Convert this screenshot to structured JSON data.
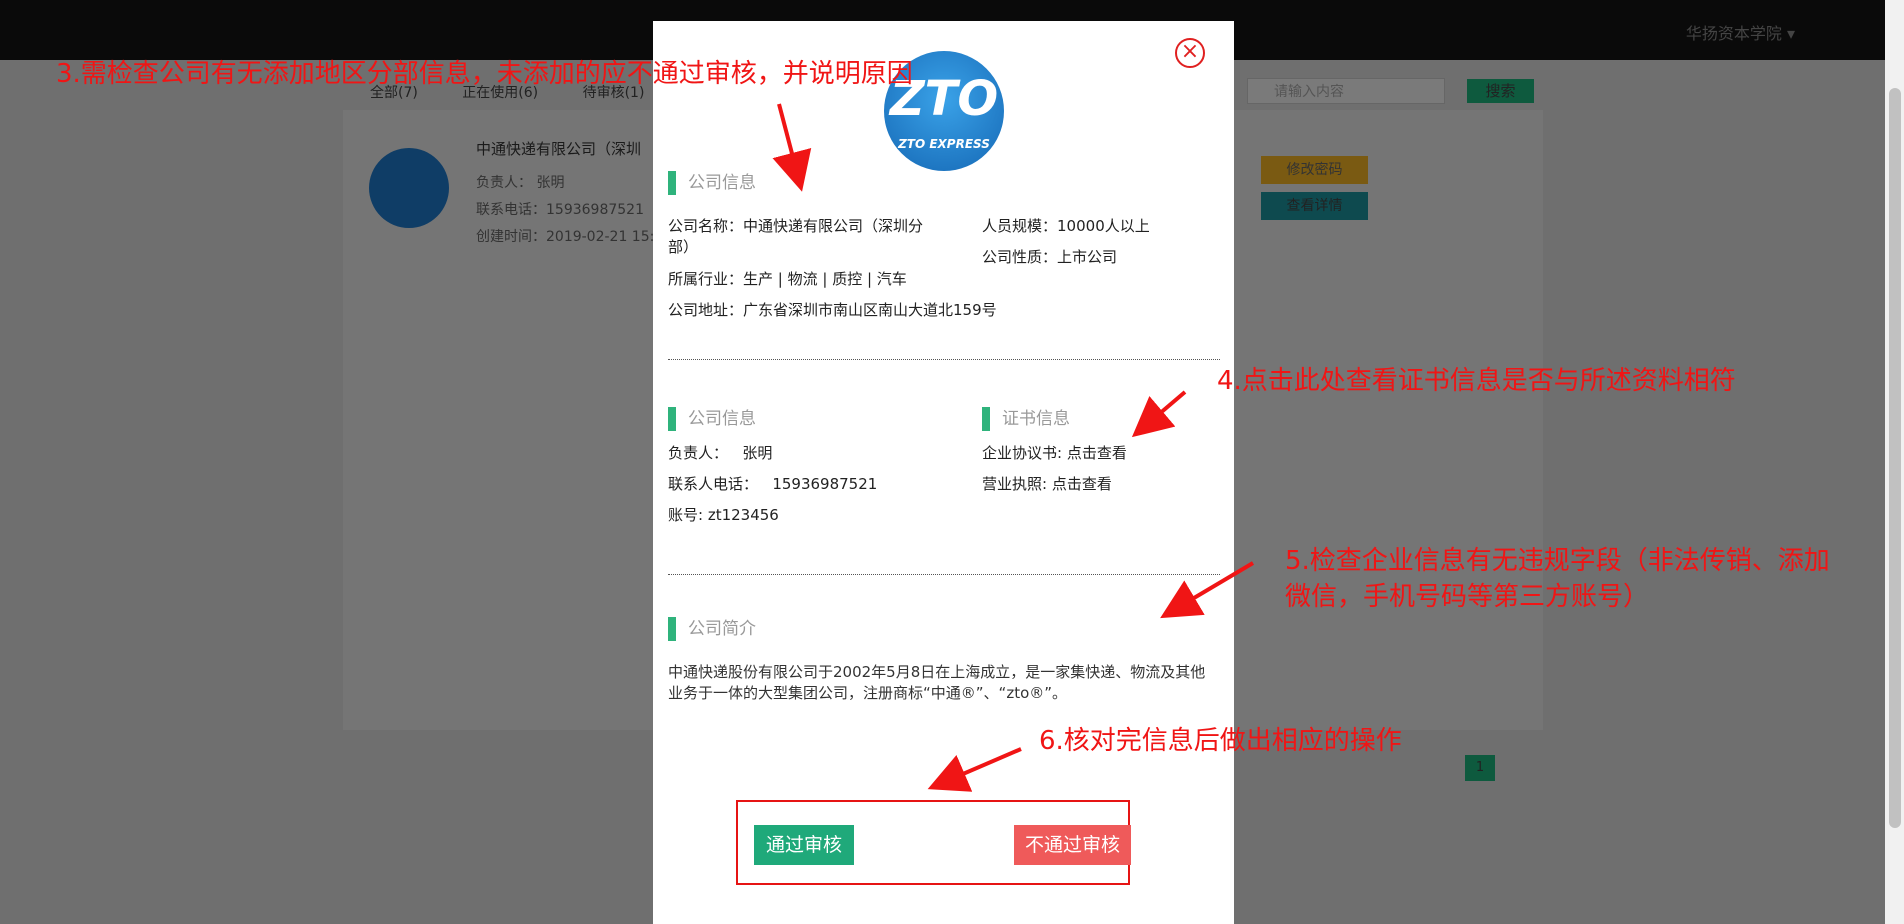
{
  "header": {
    "user_menu": "华扬资本学院 ▾"
  },
  "background_page": {
    "tabs": [
      "全部(7)",
      "正在使用(6)",
      "待审核(1)"
    ],
    "search_placeholder": "请输入内容",
    "search_button": "搜索",
    "card": {
      "name": "中通快递有限公司（深圳",
      "contact": "负责人：   张明",
      "phone": "联系电话：15936987521",
      "created": "创建时间：2019-02-21 15:"
    },
    "btn_change_password": "修改密码",
    "btn_view_detail": "查看详情",
    "pager_current": "1"
  },
  "modal": {
    "close_icon": "×",
    "logo": {
      "mark": "ZTO",
      "sub": "ZTO EXPRESS"
    },
    "section_company": "公司信息",
    "company_name_label": "公司名称：",
    "company_name": "中通快递有限公司（深圳分部）",
    "industry_label": "所属行业：",
    "industry": "生产 | 物流 | 质控 | 汽车",
    "address_label": "公司地址：",
    "address": "广东省深圳市南山区南山大道北159号",
    "scale_label": "人员规模：",
    "scale": "10000人以上",
    "nature_label": "公司性质：",
    "nature": "上市公司",
    "section_company2": "公司信息",
    "owner_label": "负责人：",
    "owner": "张明",
    "phone_label": "联系人电话：",
    "phone": "15936987521",
    "account_label": "账号: ",
    "account": "zt123456",
    "section_cert": "证书信息",
    "agreement_label": "企业协议书: ",
    "agreement_link": "点击查看",
    "license_label": "营业执照: ",
    "license_link": "点击查看",
    "section_intro": "公司简介",
    "intro": "中通快递股份有限公司于2002年5月8日在上海成立，是一家集快递、物流及其他业务于一体的大型集团公司，注册商标“中通®”、“zto®”。",
    "btn_pass": "通过审核",
    "btn_reject": "不通过审核"
  },
  "annotations": {
    "a3": "3.需检查公司有无添加地区分部信息，未添加的应不通过审核，并说明原因",
    "a4": "4.点击此处查看证书信息是否与所述资料相符",
    "a5_line1": "5.检查企业信息有无违规字段（非法传销、添加",
    "a5_line2": "微信，手机号码等第三方账号）",
    "a6": "6.核对完信息后做出相应的操作",
    "color": "#f01515"
  }
}
